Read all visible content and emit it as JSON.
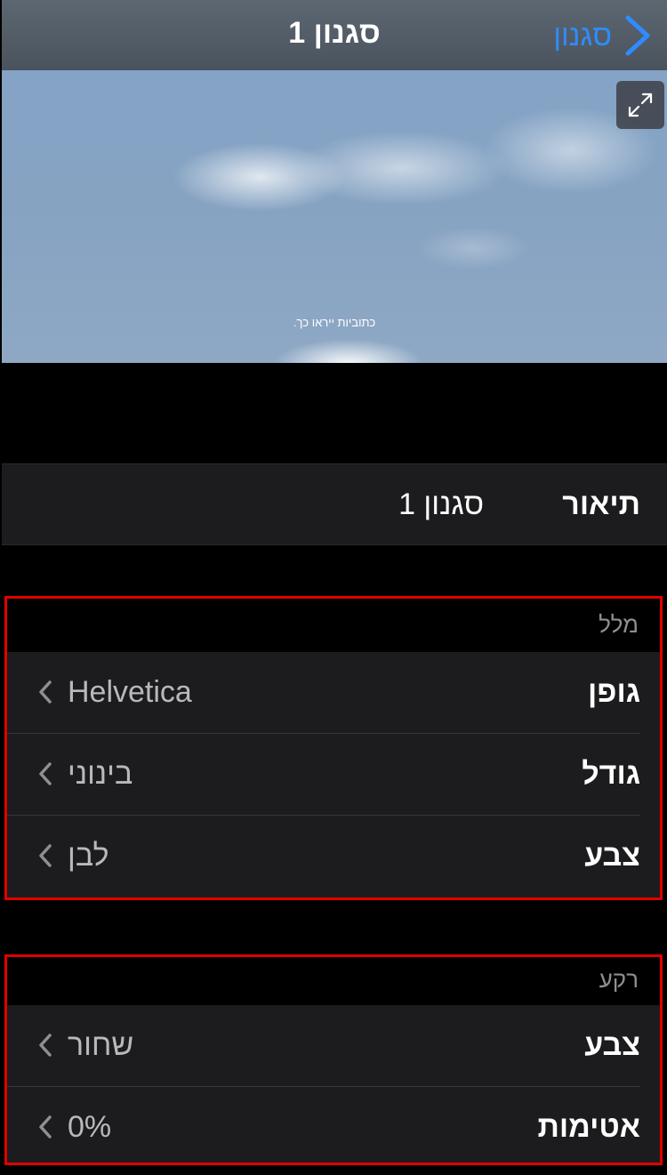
{
  "navbar": {
    "title": "סגנון 1",
    "back_label": "סגנון",
    "back_icon": "chevron-right-icon"
  },
  "preview": {
    "caption": "כתוביות ייראו כך.",
    "expand_icon": "expand-icon"
  },
  "description": {
    "label": "תיאור",
    "value": "סגנון 1"
  },
  "text_section": {
    "header": "מלל",
    "rows": [
      {
        "label": "גופן",
        "value": "Helvetica"
      },
      {
        "label": "גודל",
        "value": "בינוני"
      },
      {
        "label": "צבע",
        "value": "לבן"
      }
    ]
  },
  "background_section": {
    "header": "רקע",
    "rows": [
      {
        "label": "צבע",
        "value": "שחור"
      },
      {
        "label": "אטימות",
        "value": "0%"
      }
    ]
  },
  "colors": {
    "accent": "#2f8cff",
    "highlight_border": "#e00000",
    "cell_background": "#1c1c1e"
  }
}
